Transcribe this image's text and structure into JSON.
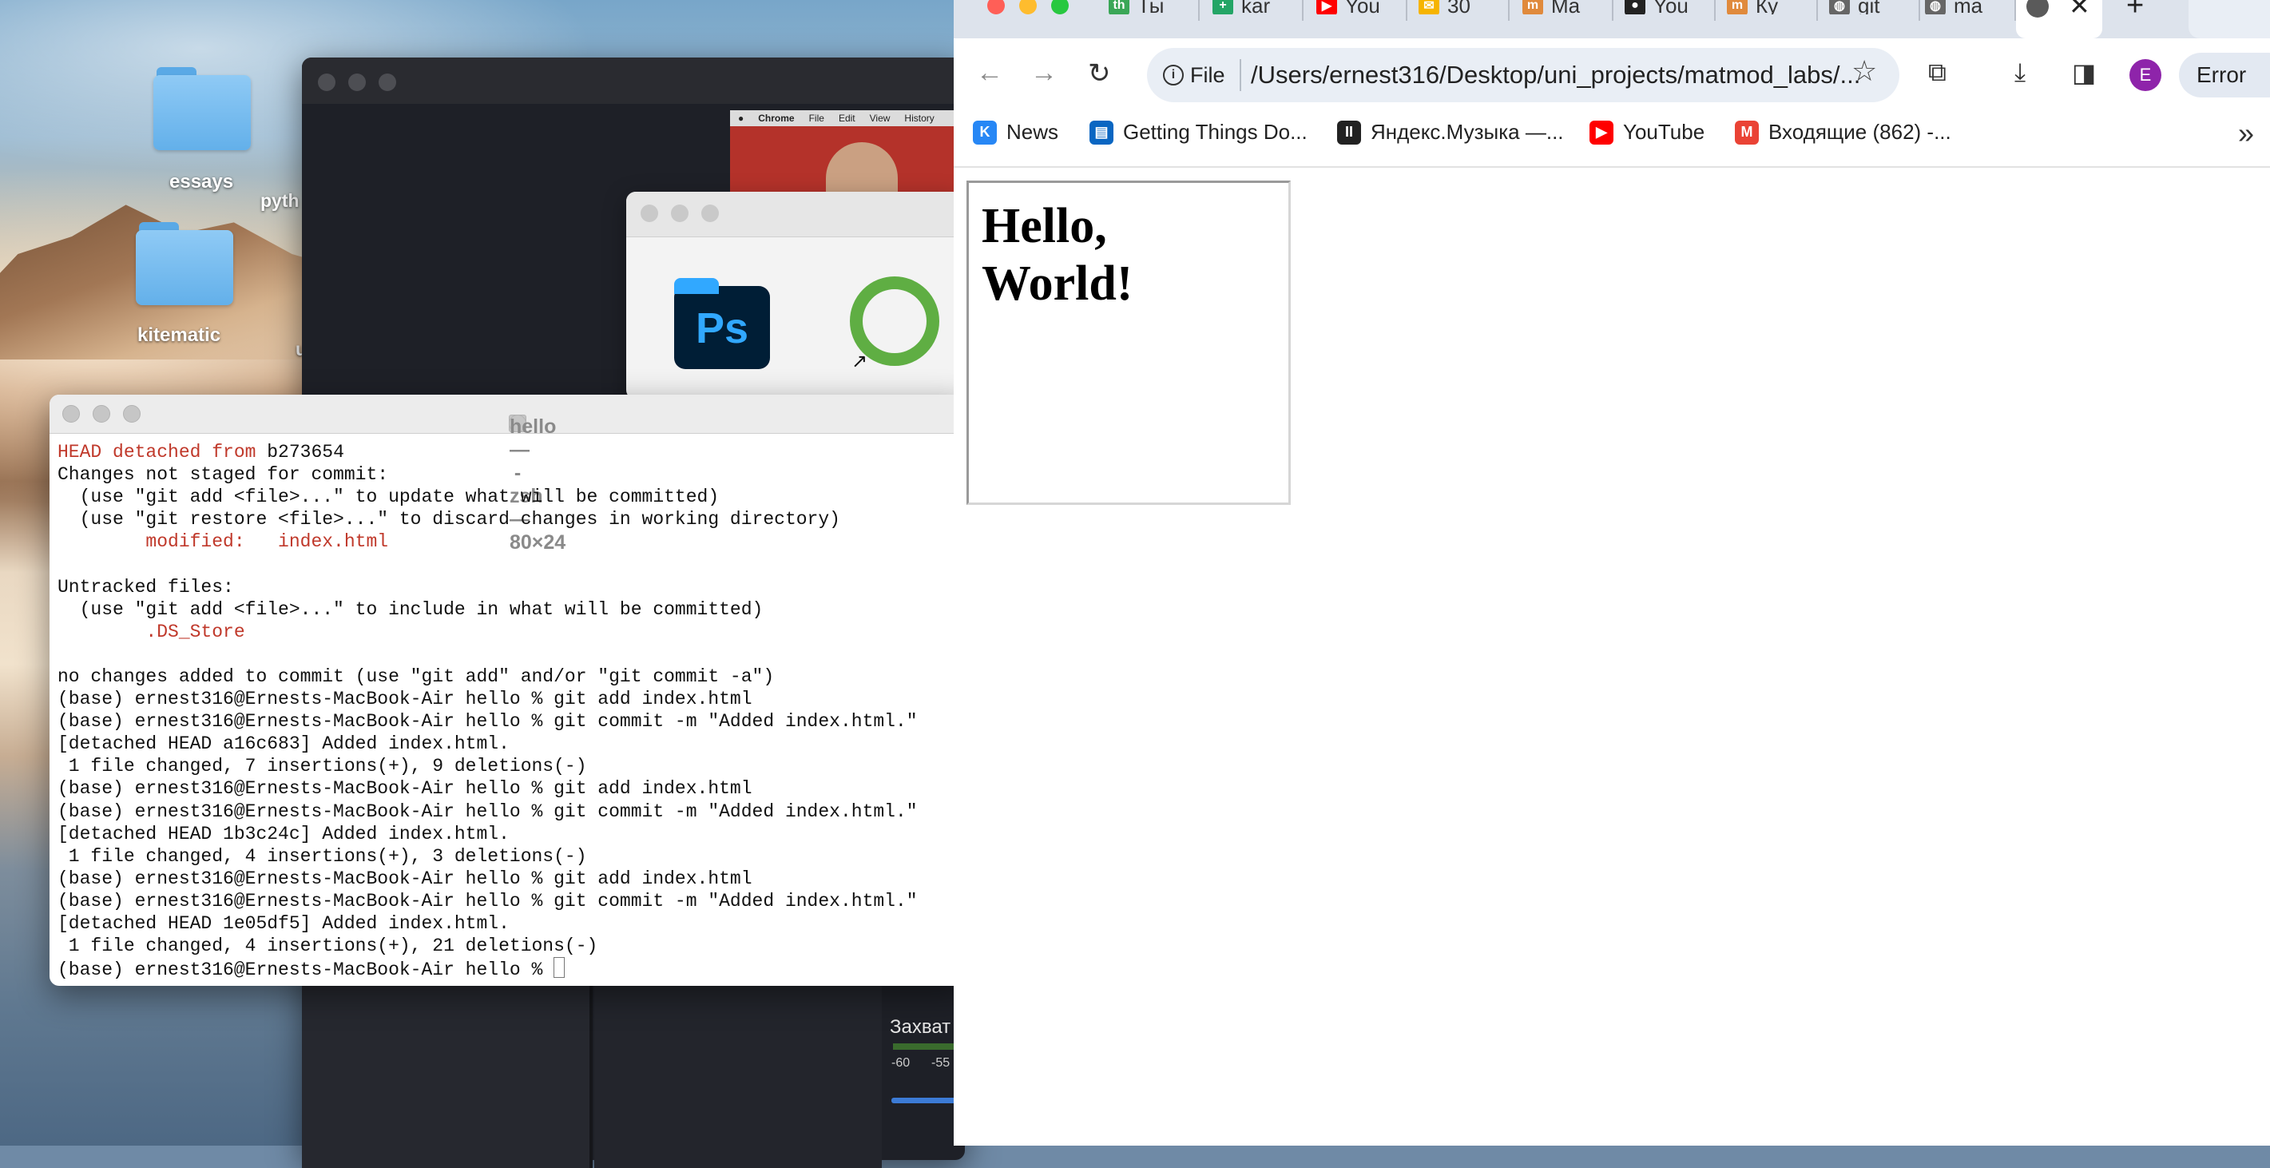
{
  "desktop": {
    "folders": [
      {
        "label": "essays"
      },
      {
        "label": "kitematic"
      }
    ],
    "partial_labels": [
      "pyth",
      "u"
    ]
  },
  "background_apps": {
    "recording_thumbnail_menu": [
      "Chrome",
      "File",
      "Edit",
      "View",
      "History"
    ],
    "launcher_icons": [
      "Ps"
    ],
    "mixer_label": "Захват",
    "mixer_ticks": [
      "-60",
      "-55"
    ]
  },
  "terminal": {
    "title": "hello — -zsh — 80×24",
    "lines": [
      {
        "text": "",
        "parts": [
          {
            "t": "HEAD detached from ",
            "c": "red"
          },
          {
            "t": "b273654",
            "c": ""
          }
        ]
      },
      {
        "parts": [
          {
            "t": "Changes not staged for commit:",
            "c": ""
          }
        ]
      },
      {
        "parts": [
          {
            "t": "  (use \"git add <file>...\" to update what will be committed)",
            "c": ""
          }
        ]
      },
      {
        "parts": [
          {
            "t": "  (use \"git restore <file>...\" to discard changes in working directory)",
            "c": ""
          }
        ]
      },
      {
        "parts": [
          {
            "t": "        modified:   index.html",
            "c": "red"
          }
        ]
      },
      {
        "parts": [
          {
            "t": "",
            "c": ""
          }
        ]
      },
      {
        "parts": [
          {
            "t": "Untracked files:",
            "c": ""
          }
        ]
      },
      {
        "parts": [
          {
            "t": "  (use \"git add <file>...\" to include in what will be committed)",
            "c": ""
          }
        ]
      },
      {
        "parts": [
          {
            "t": "        .DS_Store",
            "c": "red"
          }
        ]
      },
      {
        "parts": [
          {
            "t": "",
            "c": ""
          }
        ]
      },
      {
        "parts": [
          {
            "t": "no changes added to commit (use \"git add\" and/or \"git commit -a\")",
            "c": ""
          }
        ]
      },
      {
        "parts": [
          {
            "t": "(base) ernest316@Ernests-MacBook-Air hello % git add index.html",
            "c": ""
          }
        ]
      },
      {
        "parts": [
          {
            "t": "(base) ernest316@Ernests-MacBook-Air hello % git commit -m \"Added index.html.\"",
            "c": ""
          }
        ]
      },
      {
        "parts": [
          {
            "t": "[detached HEAD a16c683] Added index.html.",
            "c": ""
          }
        ]
      },
      {
        "parts": [
          {
            "t": " 1 file changed, 7 insertions(+), 9 deletions(-)",
            "c": ""
          }
        ]
      },
      {
        "parts": [
          {
            "t": "(base) ernest316@Ernests-MacBook-Air hello % git add index.html",
            "c": ""
          }
        ]
      },
      {
        "parts": [
          {
            "t": "(base) ernest316@Ernests-MacBook-Air hello % git commit -m \"Added index.html.\"",
            "c": ""
          }
        ]
      },
      {
        "parts": [
          {
            "t": "[detached HEAD 1b3c24c] Added index.html.",
            "c": ""
          }
        ]
      },
      {
        "parts": [
          {
            "t": " 1 file changed, 4 insertions(+), 3 deletions(-)",
            "c": ""
          }
        ]
      },
      {
        "parts": [
          {
            "t": "(base) ernest316@Ernests-MacBook-Air hello % git add index.html",
            "c": ""
          }
        ]
      },
      {
        "parts": [
          {
            "t": "(base) ernest316@Ernests-MacBook-Air hello % git commit -m \"Added index.html.\"",
            "c": ""
          }
        ]
      },
      {
        "parts": [
          {
            "t": "[detached HEAD 1e05df5] Added index.html.",
            "c": ""
          }
        ]
      },
      {
        "parts": [
          {
            "t": " 1 file changed, 4 insertions(+), 21 deletions(-)",
            "c": ""
          }
        ]
      },
      {
        "parts": [
          {
            "t": "(base) ernest316@Ernests-MacBook-Air hello % ",
            "c": ""
          }
        ],
        "cursor": true
      }
    ]
  },
  "chrome": {
    "tabs": [
      {
        "label": "Ты",
        "icon": "th-icon",
        "color": "#3aa757",
        "glyph": "th"
      },
      {
        "label": "kar",
        "icon": "sheets-icon",
        "color": "#23a566",
        "glyph": "+"
      },
      {
        "label": "You",
        "icon": "youtube-icon",
        "color": "#ff0000",
        "glyph": "▶"
      },
      {
        "label": "30",
        "icon": "mail-icon",
        "color": "#f6b400",
        "glyph": "✉"
      },
      {
        "label": "Ma",
        "icon": "m-icon",
        "color": "#e08a3c",
        "glyph": "m"
      },
      {
        "label": "You",
        "icon": "github-icon",
        "color": "#222222",
        "glyph": "●"
      },
      {
        "label": "Ку",
        "icon": "m-icon",
        "color": "#e08a3c",
        "glyph": "m"
      },
      {
        "label": "git",
        "icon": "globe-icon",
        "color": "#666666",
        "glyph": "◍"
      },
      {
        "label": "ma",
        "icon": "globe-icon",
        "color": "#666666",
        "glyph": "◍"
      }
    ],
    "active_tab_close": "✕",
    "new_tab": "+",
    "omnibox": {
      "scheme_label": "File",
      "url": "/Users/ernest316/Desktop/uni_projects/matmod_labs/..."
    },
    "profile_initial": "E",
    "error_button": "Error",
    "bookmarks": [
      {
        "label": "News",
        "icon": "vk-icon",
        "color": "#2787f5",
        "glyph": "K"
      },
      {
        "label": "Getting Things Do...",
        "icon": "trello-icon",
        "color": "#0a66c2",
        "glyph": "▤"
      },
      {
        "label": "Яндекс.Музыка —...",
        "icon": "pause-icon",
        "color": "#222222",
        "glyph": "II"
      },
      {
        "label": "YouTube",
        "icon": "youtube-icon",
        "color": "#ff0000",
        "glyph": "▶"
      },
      {
        "label": "Входящие (862) -...",
        "icon": "gmail-icon",
        "color": "#ea4335",
        "glyph": "M"
      }
    ],
    "page": {
      "heading": "Hello, World!"
    }
  }
}
